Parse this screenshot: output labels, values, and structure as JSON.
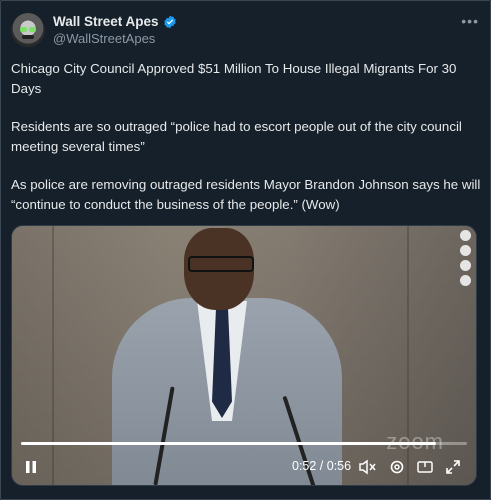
{
  "user": {
    "display_name": "Wall Street Apes",
    "handle": "@WallStreetApes",
    "verified": true
  },
  "tweet": {
    "paragraphs": [
      "Chicago City Council Approved $51 Million To House Illegal Migrants For 30 Days",
      "Residents are so outraged “police had to escort people out of the city council meeting several times”",
      "As police are removing outraged residents Mayor Brandon Johnson says he will “continue to conduct the business of the people.” (Wow)"
    ]
  },
  "video": {
    "current_time": "0:52",
    "duration": "0:56",
    "time_display": "0:52 / 0:56",
    "progress_fraction": 0.93,
    "watermark": "zoom",
    "controls": [
      "pause-icon",
      "mute-icon",
      "settings-icon",
      "pip-icon",
      "fullscreen-icon"
    ]
  },
  "colors": {
    "background": "#15202b",
    "verified_badge": "#1d9bf0",
    "secondary_text": "#8b98a5"
  }
}
